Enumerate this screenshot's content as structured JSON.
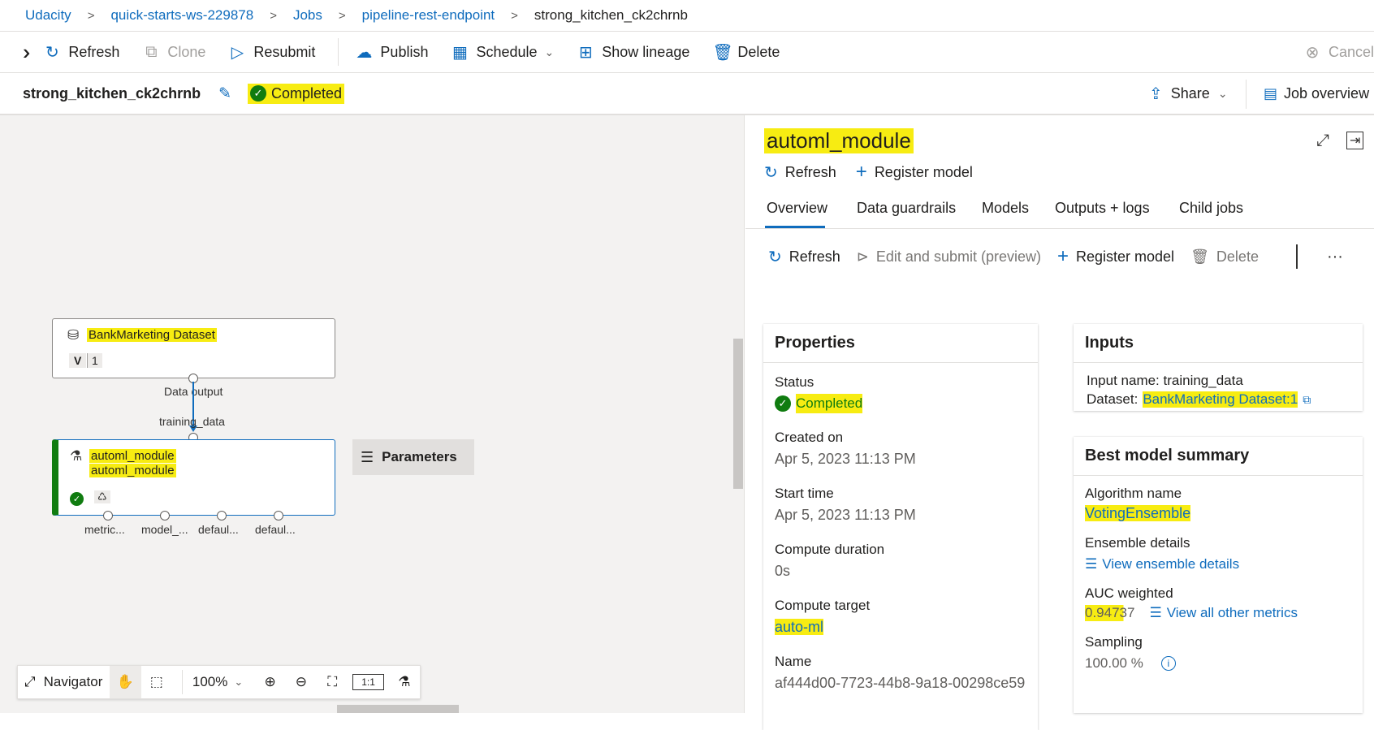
{
  "breadcrumb": [
    "Udacity",
    "quick-starts-ws-229878",
    "Jobs",
    "pipeline-rest-endpoint",
    "strong_kitchen_ck2chrnb"
  ],
  "toolbar": {
    "refresh": "Refresh",
    "clone": "Clone",
    "resubmit": "Resubmit",
    "publish": "Publish",
    "schedule": "Schedule",
    "show_lineage": "Show lineage",
    "delete": "Delete",
    "cancel": "Cancel"
  },
  "job": {
    "name": "strong_kitchen_ck2chrnb",
    "status": "Completed",
    "share": "Share",
    "job_overview": "Job overview"
  },
  "canvas": {
    "dataset_node": {
      "title": "BankMarketing Dataset",
      "version_tag": "V",
      "version": "1",
      "output_label": "Data output"
    },
    "edge_label": "training_data",
    "automl_node": {
      "title": "automl_module",
      "subtitle": "automl_module",
      "outputs": [
        "metric...",
        "model_...",
        "defaul...",
        "defaul..."
      ]
    },
    "parameters_button": "Parameters",
    "navigator": {
      "label": "Navigator",
      "zoom": "100%"
    }
  },
  "panel": {
    "title": "automl_module",
    "actions": {
      "refresh": "Refresh",
      "register_model": "Register model"
    },
    "tabs": [
      "Overview",
      "Data guardrails",
      "Models",
      "Outputs + logs",
      "Child jobs"
    ],
    "subactions": {
      "refresh": "Refresh",
      "edit_submit": "Edit and submit (preview)",
      "register_model": "Register model",
      "delete": "Delete",
      "more": "···"
    },
    "properties": {
      "header": "Properties",
      "status_label": "Status",
      "status_value": "Completed",
      "created_label": "Created on",
      "created_value": "Apr 5, 2023 11:13 PM",
      "start_label": "Start time",
      "start_value": "Apr 5, 2023 11:13 PM",
      "duration_label": "Compute duration",
      "duration_value": "0s",
      "target_label": "Compute target",
      "target_value": "auto-ml",
      "name_label": "Name",
      "name_value": "af444d00-7723-44b8-9a18-00298ce59"
    },
    "inputs": {
      "header": "Inputs",
      "input_name": "Input name: training_data",
      "dataset_prefix": "Dataset:",
      "dataset_value": "BankMarketing Dataset:1"
    },
    "best_model": {
      "header": "Best model summary",
      "algo_label": "Algorithm name",
      "algo_value": "VotingEnsemble",
      "ensemble_label": "Ensemble details",
      "ensemble_link": "View ensemble details",
      "auc_label": "AUC weighted",
      "auc_value": "0.94737",
      "metrics_link": "View all other metrics",
      "sampling_label": "Sampling",
      "sampling_value": "100.00 %"
    }
  }
}
